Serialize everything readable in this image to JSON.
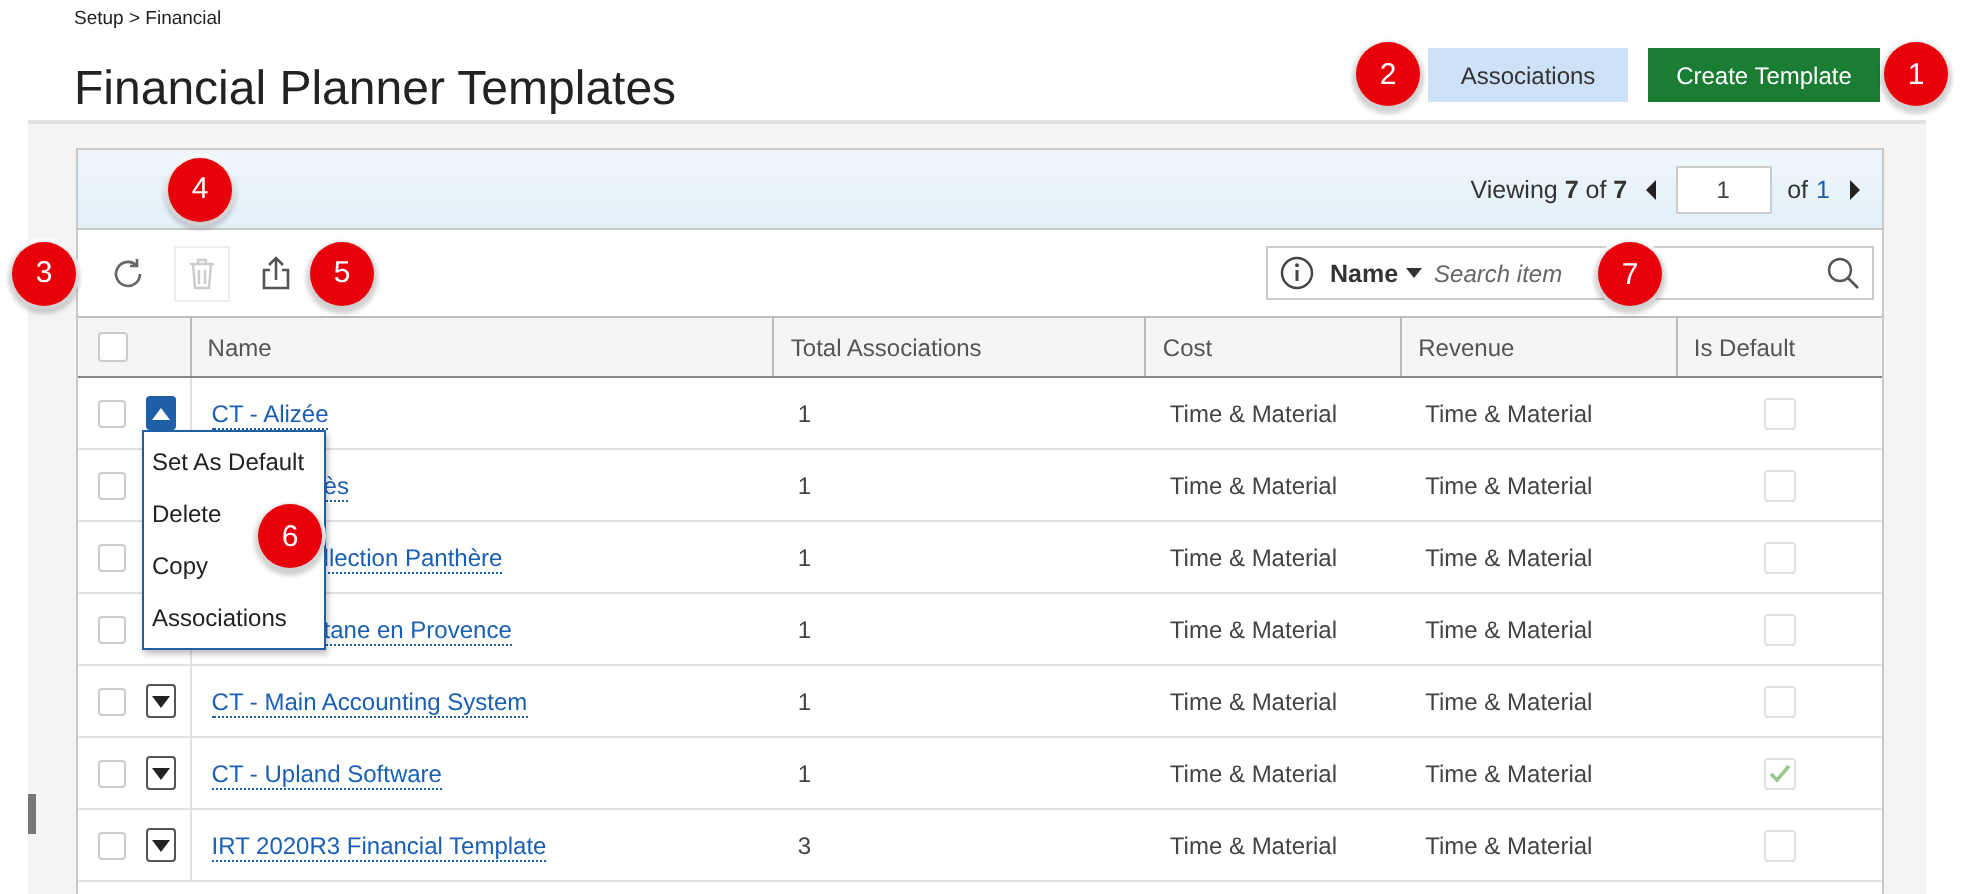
{
  "breadcrumb": "Setup > Financial",
  "title": "Financial Planner Templates",
  "buttons": [
    {
      "label": "Associations",
      "kind": "secondary",
      "callout": "2"
    },
    {
      "label": "Create Template",
      "kind": "primary",
      "callout": "1"
    }
  ],
  "pager": {
    "summary": "Viewing **7** of **7**",
    "page": "1",
    "of_label": "of",
    "total_pages": "1"
  },
  "toolbar": [
    {
      "kind": "refresh",
      "disabled": false,
      "callout": "3"
    },
    {
      "kind": "delete",
      "disabled": true,
      "callout": "4"
    },
    {
      "kind": "export",
      "disabled": false,
      "callout": "5"
    }
  ],
  "search": {
    "field": "Name",
    "placeholder": "Search item",
    "callout": "7"
  },
  "table": {
    "select_all_checked": false,
    "columns": [
      "Name",
      "Total Associations",
      "Cost",
      "Revenue",
      "Is Default"
    ],
    "rows": [
      {
        "checked": false,
        "menu_open": true,
        "name": "CT - Alizée",
        "total": "1",
        "cost": "Time & Material",
        "revenue": "Time & Material",
        "is_default": false
      },
      {
        "checked": false,
        "name": "ès",
        "total": "1",
        "cost": "Time & Material",
        "revenue": "Time & Material",
        "is_default": false
      },
      {
        "checked": false,
        "name": "llection Panthère",
        "total": "1",
        "cost": "Time & Material",
        "revenue": "Time & Material",
        "is_default": false
      },
      {
        "checked": false,
        "name": "tane en Provence",
        "total": "1",
        "cost": "Time & Material",
        "revenue": "Time & Material",
        "is_default": false
      },
      {
        "checked": false,
        "menu_open": false,
        "name": "CT - Main Accounting System",
        "total": "1",
        "cost": "Time & Material",
        "revenue": "Time & Material",
        "is_default": false
      },
      {
        "checked": false,
        "menu_open": false,
        "name": "CT - Upland Software",
        "total": "1",
        "cost": "Time & Material",
        "revenue": "Time & Material",
        "is_default": true
      },
      {
        "checked": false,
        "menu_open": false,
        "name": "IRT 2020R3 Financial Template",
        "total": "3",
        "cost": "Time & Material",
        "revenue": "Time & Material",
        "is_default": false
      }
    ],
    "row_menu": {
      "items": [
        "Set As Default",
        "Delete",
        "Copy",
        "Associations"
      ],
      "callout": "6"
    }
  }
}
